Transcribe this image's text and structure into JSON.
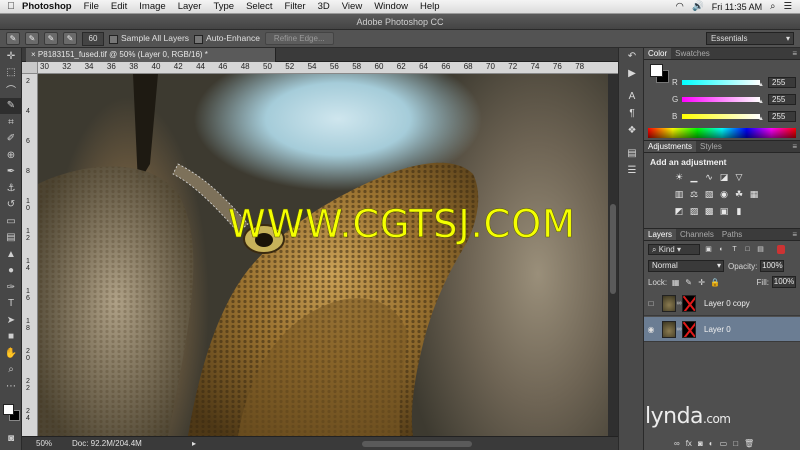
{
  "menubar": {
    "app": "Photoshop",
    "items": [
      "File",
      "Edit",
      "Image",
      "Layer",
      "Type",
      "Select",
      "Filter",
      "3D",
      "View",
      "Window",
      "Help"
    ],
    "clock": "Fri 11:35 AM"
  },
  "window": {
    "title": "Adobe Photoshop CC"
  },
  "options": {
    "brush_size": "60",
    "sample_all_layers": "Sample All Layers",
    "auto_enhance": "Auto-Enhance",
    "refine_edge": "Refine Edge...",
    "workspace": "Essentials"
  },
  "document": {
    "tab_title": "P8183151_fused.tif @ 50% (Layer 0, RGB/16) *",
    "ruler_top": [
      "30",
      "32",
      "34",
      "36",
      "38",
      "40",
      "42",
      "44",
      "46",
      "48",
      "50",
      "52",
      "54",
      "56",
      "58",
      "60",
      "62",
      "64",
      "66",
      "68",
      "70",
      "72",
      "74",
      "76",
      "78"
    ],
    "ruler_left": [
      "2",
      "4",
      "6",
      "8",
      "1\n0",
      "1\n2",
      "1\n4",
      "1\n6",
      "1\n8",
      "2\n0",
      "2\n2",
      "2\n4"
    ],
    "watermark": "WWW.CGTSJ.COM",
    "zoom": "50%",
    "doc_size": "Doc: 92.2M/204.4M"
  },
  "color_panel": {
    "tabs": [
      "Color",
      "Swatches"
    ],
    "channels": [
      {
        "label": "R",
        "value": "255",
        "gradient": "linear-gradient(90deg,#00ffff,#ffffff)"
      },
      {
        "label": "G",
        "value": "255",
        "gradient": "linear-gradient(90deg,#ff00ff,#ffffff)"
      },
      {
        "label": "B",
        "value": "255",
        "gradient": "linear-gradient(90deg,#ffff00,#ffffff)"
      }
    ]
  },
  "adjustments_panel": {
    "tabs": [
      "Adjustments",
      "Styles"
    ],
    "title": "Add an adjustment"
  },
  "layers_panel": {
    "tabs": [
      "Layers",
      "Channels",
      "Paths"
    ],
    "kind": "Kind",
    "blend_mode": "Normal",
    "opacity_label": "Opacity:",
    "opacity": "100%",
    "lock_label": "Lock:",
    "fill_label": "Fill:",
    "fill": "100%",
    "layers": [
      {
        "name": "Layer 0 copy",
        "visible": false,
        "selected": false
      },
      {
        "name": "Layer 0",
        "visible": true,
        "selected": true
      }
    ]
  },
  "branding": {
    "logo": "lynda",
    "suffix": ".com"
  },
  "colors": {
    "accent_selected_layer": "#6b7d93",
    "watermark": "#f4ff00"
  }
}
